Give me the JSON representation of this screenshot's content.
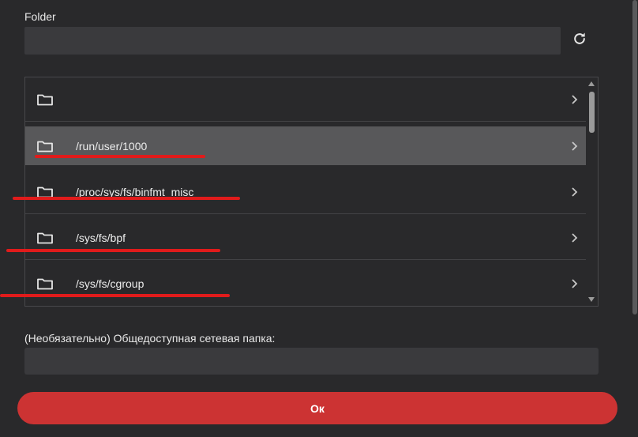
{
  "folder": {
    "label": "Folder",
    "value": ""
  },
  "folder_list": {
    "items": [
      {
        "path": "",
        "selected": false
      },
      {
        "path": "/run/user/1000",
        "selected": true
      },
      {
        "path": "/proc/sys/fs/binfmt_misc",
        "selected": false
      },
      {
        "path": "/sys/fs/bpf",
        "selected": false
      },
      {
        "path": "/sys/fs/cgroup",
        "selected": false
      }
    ]
  },
  "share": {
    "label": "(Необязательно) Общедоступная сетевая папка:",
    "value": ""
  },
  "ok_button": {
    "label": "Ок"
  },
  "colors": {
    "accent": "#cc3333",
    "annotation": "#e01b1b"
  }
}
